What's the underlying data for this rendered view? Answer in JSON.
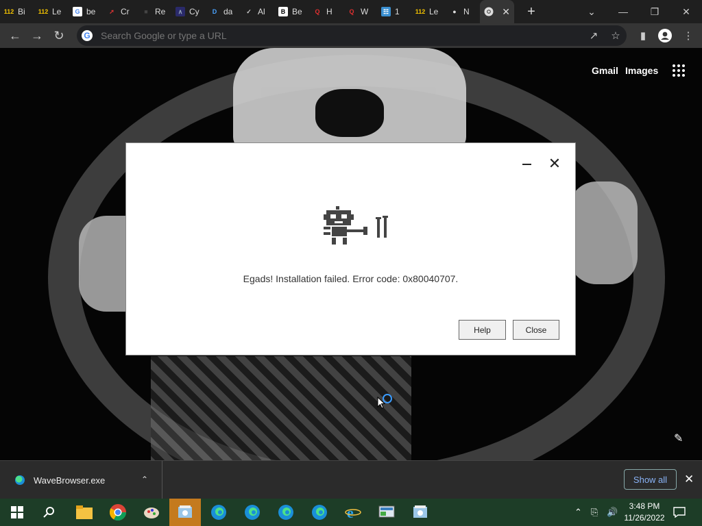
{
  "browser": {
    "tabs": [
      {
        "fav_text": "112",
        "fav_color": "#f5c400",
        "fav_bg": "transparent",
        "title": "Bi"
      },
      {
        "fav_text": "112",
        "fav_color": "#f5c400",
        "fav_bg": "transparent",
        "title": "Le"
      },
      {
        "fav_text": "G",
        "fav_color": "#4285f4",
        "fav_bg": "#ffffff",
        "title": "be"
      },
      {
        "fav_text": "➚",
        "fav_color": "#d33",
        "fav_bg": "transparent",
        "title": "Cr"
      },
      {
        "fav_text": "■",
        "fav_color": "#444",
        "fav_bg": "transparent",
        "title": "Re"
      },
      {
        "fav_text": "∧",
        "fav_color": "#9ab",
        "fav_bg": "#2a2a6a",
        "title": "Cy"
      },
      {
        "fav_text": "D",
        "fav_color": "#4aa3ff",
        "fav_bg": "transparent",
        "title": "da"
      },
      {
        "fav_text": "✓",
        "fav_color": "#ccc",
        "fav_bg": "transparent",
        "title": "Al"
      },
      {
        "fav_text": "B",
        "fav_color": "#000",
        "fav_bg": "#ffffff",
        "title": "Be"
      },
      {
        "fav_text": "Q",
        "fav_color": "#e03030",
        "fav_bg": "transparent",
        "title": "H"
      },
      {
        "fav_text": "Q",
        "fav_color": "#e03030",
        "fav_bg": "transparent",
        "title": "W"
      },
      {
        "fav_text": "☷",
        "fav_color": "#fff",
        "fav_bg": "#3a8fd0",
        "title": "1"
      },
      {
        "fav_text": "112",
        "fav_color": "#f5c400",
        "fav_bg": "transparent",
        "title": "Le"
      },
      {
        "fav_text": "●",
        "fav_color": "#ddd",
        "fav_bg": "transparent",
        "title": "N"
      }
    ],
    "active_tab": {
      "fav_text": "●",
      "title": "",
      "close": "✕"
    },
    "new_tab": "+",
    "omnibox_placeholder": "Search Google or type a URL"
  },
  "page": {
    "links": {
      "gmail": "Gmail",
      "images": "Images"
    }
  },
  "dialog": {
    "message": "Egads! Installation failed. Error code: 0x80040707.",
    "help_label": "Help",
    "close_label": "Close"
  },
  "downloads": {
    "file_name": "WaveBrowser.exe",
    "show_all": "Show all"
  },
  "taskbar": {
    "time": "3:48 PM",
    "date": "11/26/2022"
  }
}
